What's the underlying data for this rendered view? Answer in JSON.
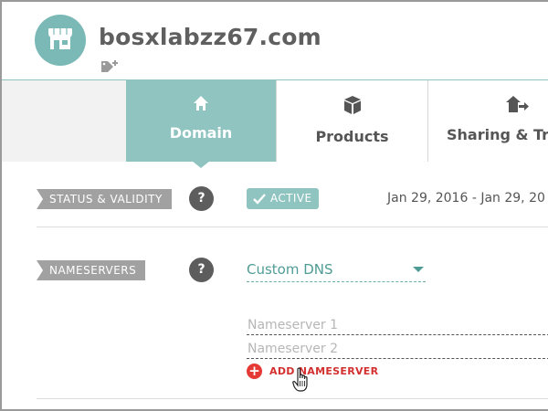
{
  "header": {
    "domain_name": "bosxlabzz67.com",
    "avatar_icon": "storefront-icon",
    "tag_icon": "add-tag-icon"
  },
  "tabs": [
    {
      "label": "",
      "icon": ""
    },
    {
      "label": "Domain",
      "icon": "home-icon",
      "active": true
    },
    {
      "label": "Products",
      "icon": "box-icon"
    },
    {
      "label": "Sharing & Tra",
      "icon": "house-share-icon"
    }
  ],
  "status": {
    "label": "STATUS & VALIDITY",
    "help": "?",
    "badge": "ACTIVE",
    "validity_dates": "Jan 29, 2016 - Jan 29, 20"
  },
  "nameservers": {
    "label": "NAMESERVERS",
    "help": "?",
    "dns_option": "Custom DNS",
    "ns1_placeholder": "Nameserver 1",
    "ns2_placeholder": "Nameserver 2",
    "add_label": "ADD NAMESERVER"
  },
  "colors": {
    "accent": "#8fc4c0",
    "add_red": "#e53935"
  }
}
